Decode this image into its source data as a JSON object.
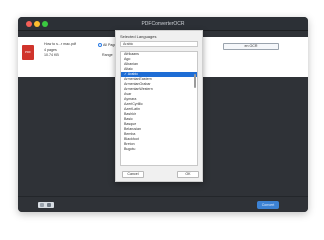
{
  "window": {
    "title": "PDFConverterOCR"
  },
  "file": {
    "name": "How to s...r mac.pdf",
    "pages": "4 pages",
    "size": "10.74 KB",
    "all_pages_label": "All Pages",
    "range_label": "Range"
  },
  "language_button": {
    "label": "en OCR"
  },
  "dialog": {
    "title": "Selected Languages",
    "search_value": "Arabic",
    "languages": [
      "Afrikaans",
      "Ago",
      "Albanian",
      "Altaic",
      "Arabic",
      "ArmenianEastern",
      "ArmenianGrabar",
      "ArmenianWestern",
      "Avar",
      "Aymara",
      "AzeriCyrillic",
      "AzeriLatin",
      "Bashkir",
      "Basic",
      "Basque",
      "Belarusian",
      "Bemba",
      "Blackfoot",
      "Breton",
      "Bugotu"
    ],
    "selected_language": "Arabic",
    "cancel_label": "Cancel",
    "ok_label": "OK"
  },
  "bottom": {
    "convert_label": "Convert"
  }
}
